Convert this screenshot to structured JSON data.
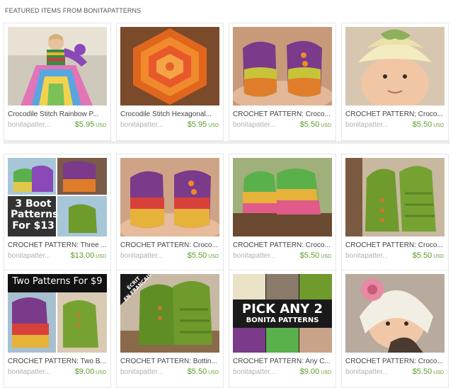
{
  "section_title": "FEATURED ITEMS FROM BONITAPATTERNS",
  "currency": "USD",
  "items": [
    {
      "title": "Crocodile Stitch Rainbow P...",
      "shop": "bonitapatter...",
      "price": "$5.95",
      "image": "rainbow-tutu-dress-photo"
    },
    {
      "title": "Crocodile Stitch Hexagonal...",
      "shop": "bonitapatter...",
      "price": "$5.95",
      "image": "orange-hexagon-photo"
    },
    {
      "title": "CROCHET PATTERN: Croco...",
      "shop": "bonitapatter...",
      "price": "$5.50",
      "image": "baby-booties-in-hands-photo"
    },
    {
      "title": "CROCHET PATTERN; Croco...",
      "shop": "bonitapatter...",
      "price": "$5.50",
      "image": "baby-in-green-hat-photo"
    },
    {
      "title": "CROCHET PATTERN: Three ...",
      "shop": "bonitapatter...",
      "price": "$13.00",
      "image": "three-boot-patterns-photo",
      "overlay": [
        "3 Boot",
        "Patterns",
        "For $13"
      ]
    },
    {
      "title": "CROCHET PATTERN: Croco...",
      "shop": "bonitapatter...",
      "price": "$5.50",
      "image": "rainbow-booties-in-hands-photo"
    },
    {
      "title": "CROCHET PATTERN: Croco...",
      "shop": "bonitapatter...",
      "price": "$5.50",
      "image": "rainbow-booties-on-wood-photo"
    },
    {
      "title": "CROCHET PATTERN: Croco...",
      "shop": "bonitapatter...",
      "price": "$5.50",
      "image": "green-slipper-boots-photo"
    },
    {
      "title": "CROCHET PATTERN: Two B...",
      "shop": "bonitapatter...",
      "price": "$9.00",
      "image": "two-patterns-photo",
      "overlay": [
        "Two Patterns For $9"
      ]
    },
    {
      "title": "CROCHET PATTERN: Bottin...",
      "shop": "bonitapatter...",
      "price": "$5.50",
      "image": "green-boots-french-photo",
      "overlay": [
        "ÉCRIT",
        "EN FRANÇAIS"
      ]
    },
    {
      "title": "CROCHET PATTERN: Any C...",
      "shop": "bonitapatter...",
      "price": "$9.00",
      "image": "pick-any-two-photo",
      "overlay": [
        "PICK ANY 2",
        "BONITA PATTERNS"
      ]
    },
    {
      "title": "CROCHET PATTERN: Croco...",
      "shop": "bonitapatter...",
      "price": "$5.50",
      "image": "baby-in-flower-hat-photo"
    }
  ]
}
